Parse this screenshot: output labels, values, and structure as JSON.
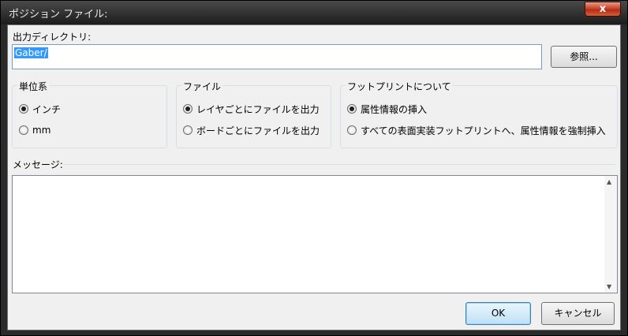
{
  "dialog": {
    "title": "ポジション ファイル:",
    "close_label": "x"
  },
  "output_dir": {
    "label": "出力ディレクトリ:",
    "value": "Gaber/",
    "browse_label": "参照..."
  },
  "units": {
    "title": "単位系",
    "options": [
      {
        "label": "インチ",
        "selected": true
      },
      {
        "label": "mm",
        "selected": false
      }
    ]
  },
  "files": {
    "title": "ファイル",
    "options": [
      {
        "label": "レイヤごとにファイルを出力",
        "selected": true
      },
      {
        "label": "ボードごとにファイルを出力",
        "selected": false
      }
    ]
  },
  "footprints": {
    "title": "フットプリントについて",
    "options": [
      {
        "label": "属性情報の挿入",
        "selected": true
      },
      {
        "label": "すべての表面実装フットプリントへ、属性情報を強制挿入",
        "selected": false
      }
    ]
  },
  "messages": {
    "label": "メッセージ:",
    "scroll_up": "▲",
    "scroll_down": "▼"
  },
  "buttons": {
    "ok": "OK",
    "cancel": "キャンセル"
  }
}
